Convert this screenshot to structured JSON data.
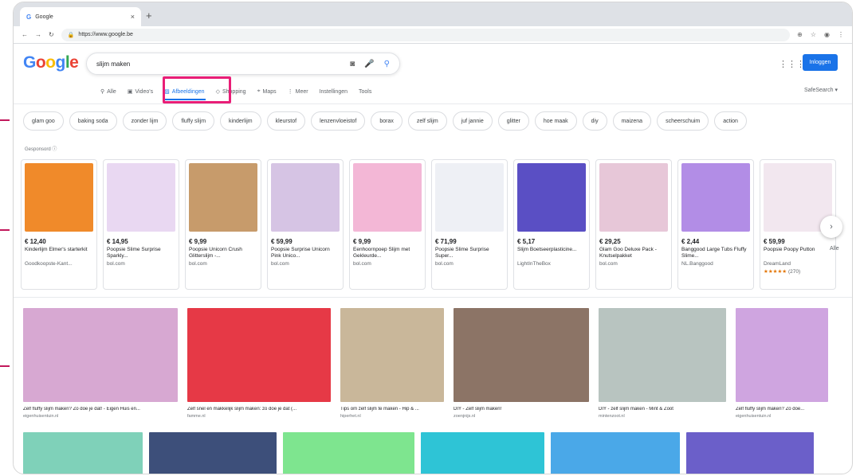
{
  "browser": {
    "tab_title": "Google",
    "url": "https://www.google.be"
  },
  "logo": "Google",
  "search": {
    "query": "slijm maken"
  },
  "login_label": "Inloggen",
  "nav_tabs": [
    {
      "label": "Alle",
      "icon": "search-icon"
    },
    {
      "label": "Video's",
      "icon": "video-icon"
    },
    {
      "label": "Afbeeldingen",
      "icon": "image-icon",
      "active": true
    },
    {
      "label": "Shopping",
      "icon": "tag-icon"
    },
    {
      "label": "Maps",
      "icon": "map-icon"
    },
    {
      "label": "Meer",
      "icon": "more-icon"
    },
    {
      "label": "Instellingen"
    },
    {
      "label": "Tools"
    }
  ],
  "safesearch": "SafeSearch ▾",
  "chips": [
    "glam goo",
    "baking soda",
    "zonder lijm",
    "fluffy slijm",
    "kinderlijm",
    "kleurstof",
    "lenzenvloeistof",
    "borax",
    "zelf slijm",
    "juf jannie",
    "glitter",
    "hoe maak",
    "diy",
    "maizena",
    "scheerschuim",
    "action"
  ],
  "sponsored": "Gesponsord ⓘ",
  "products": [
    {
      "price": "€ 12,40",
      "name": "Kinderlijm Elmer's starterkit",
      "store": "Goodkoopste-Kant...",
      "color": "#f08a2a"
    },
    {
      "price": "€ 14,95",
      "name": "Poopsie Slime Surprise Sparkly...",
      "store": "bol.com",
      "color": "#e9d8f2"
    },
    {
      "price": "€ 9,99",
      "name": "Poopsie Unicorn Crush Glitterslijm -...",
      "store": "bol.com",
      "color": "#c79b6b"
    },
    {
      "price": "€ 59,99",
      "name": "Poopsie Surprise Unicorn Pink Unico...",
      "store": "bol.com",
      "color": "#d6c4e4"
    },
    {
      "price": "€ 9,99",
      "name": "Eenhoornpoep Slijm met Gekleurde...",
      "store": "bol.com",
      "color": "#f3b7d6"
    },
    {
      "price": "€ 71,99",
      "name": "Poopsie Slime Surprise Super...",
      "store": "bol.com",
      "color": "#eef0f5"
    },
    {
      "price": "€ 5,17",
      "name": "Slijm Boetseerplasticine...",
      "store": "LightInTheBox",
      "color": "#5a4fc4"
    },
    {
      "price": "€ 29,25",
      "name": "Glam Goo Deluxe Pack - Knutselpakket",
      "store": "bol.com",
      "color": "#e7c7d8"
    },
    {
      "price": "€ 2,44",
      "name": "Banggood Large Tubs Fluffy Slime...",
      "store": "NL.Banggood",
      "color": "#b28de6"
    },
    {
      "price": "€ 59,99",
      "name": "Poopsie Poopy Putton",
      "store": "DreamLand",
      "rating": "★★★★★",
      "reviews": "(270)",
      "color": "#f2e7ef"
    }
  ],
  "next_arrow": "›",
  "alle_label": "Alle",
  "results": [
    {
      "title": "Zelf fluffy slijm maken? Zo doe je dat! - Eigen Huis en...",
      "source": "eigenhuisentuin.nl",
      "color": "#d7a8d2"
    },
    {
      "title": "Zelf snel en makkelijk slijm maken: zo doe je dat (...",
      "source": "famme.nl",
      "color": "#e63946"
    },
    {
      "title": "Tips om zelf slijm te maken - Hip & ...",
      "source": "hiperhet.nl",
      "color": "#c9b79a"
    },
    {
      "title": "DIY - Zelf slijm maken!",
      "source": "zoenjnijs.nl",
      "color": "#8c7466"
    },
    {
      "title": "DIY - zelf slijm maken - Mint & Zoot",
      "source": "mintenzoot.nl",
      "color": "#b8c4c0"
    },
    {
      "title": "Zelf fluffy slijm maken? Zo doe...",
      "source": "eigenhuisentuin.nl",
      "color": "#cfa5e0"
    }
  ],
  "bottom_row_colors": [
    "#7fd1b9",
    "#3d4f7a",
    "#7ee58f",
    "#2ec4d6",
    "#4aa8e8",
    "#6b5fc9"
  ]
}
